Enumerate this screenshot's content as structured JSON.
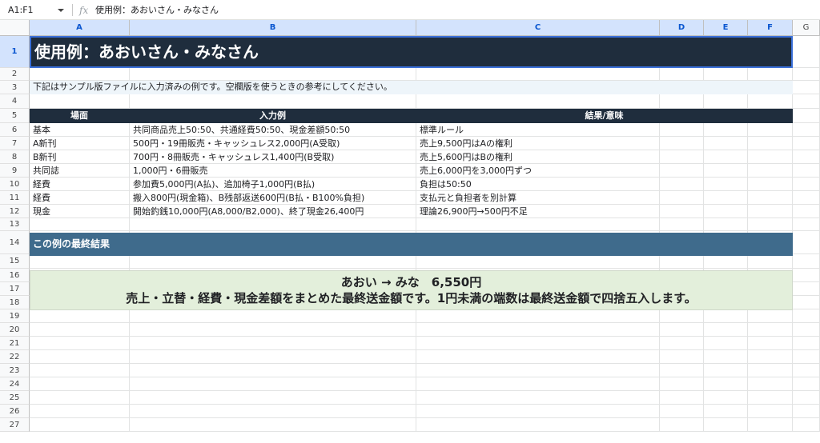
{
  "formula_bar": {
    "name_box": "A1:F1",
    "fx_label": "fx",
    "formula": "使用例：あおいさん・みなさん"
  },
  "columns": [
    {
      "letter": "A",
      "selected": true
    },
    {
      "letter": "B",
      "selected": true
    },
    {
      "letter": "C",
      "selected": true
    },
    {
      "letter": "D",
      "selected": true
    },
    {
      "letter": "E",
      "selected": true
    },
    {
      "letter": "F",
      "selected": true
    },
    {
      "letter": "G",
      "selected": false
    }
  ],
  "rows": [
    "1",
    "2",
    "3",
    "4",
    "5",
    "6",
    "7",
    "8",
    "9",
    "10",
    "11",
    "12",
    "13",
    "14",
    "15",
    "16",
    "17",
    "18",
    "19",
    "20",
    "21",
    "22",
    "23",
    "24",
    "25",
    "26",
    "27"
  ],
  "sheet": {
    "title": "使用例：あおいさん・みなさん",
    "note": "下記はサンプル版ファイルに入力済みの例です。空欄版を使うときの参考にしてください。",
    "table_header": {
      "a": "場面",
      "b": "入力例",
      "c": "結果/意味"
    },
    "table_rows": [
      {
        "a": "基本",
        "b": "共同商品売上50:50、共通経費50:50、現金差額50:50",
        "c": "標準ルール"
      },
      {
        "a": "A新刊",
        "b": "500円・19冊販売・キャッシュレス2,000円(A受取)",
        "c": "売上9,500円はAの権利"
      },
      {
        "a": "B新刊",
        "b": "700円・8冊販売・キャッシュレス1,400円(B受取)",
        "c": "売上5,600円はBの権利"
      },
      {
        "a": "共同誌",
        "b": "1,000円・6冊販売",
        "c": "売上6,000円を3,000円ずつ"
      },
      {
        "a": "経費",
        "b": "参加費5,000円(A払)、追加椅子1,000円(B払)",
        "c": "負担は50:50"
      },
      {
        "a": "経費",
        "b": "搬入800円(現金箱)、B残部返送600円(B払・B100%負担)",
        "c": "支払元と負担者を別計算"
      },
      {
        "a": "現金",
        "b": "開始釣銭10,000円(A8,000/B2,000)、終了現金26,400円",
        "c": "理論26,900円→500円不足"
      }
    ],
    "section_title": "この例の最終結果",
    "result_line1": "あおい → みな　6,550円",
    "result_line2": "売上・立替・経費・現金差額をまとめた最終送金額です。1円未満の端数は最終送金額で四捨五入します。"
  },
  "colors": {
    "title_bg": "#1f2d3d",
    "section_bg": "#3f6b8c",
    "result_bg": "#e3efdb",
    "note_bg": "#eef5fa",
    "selection": "#3a6fd8"
  }
}
